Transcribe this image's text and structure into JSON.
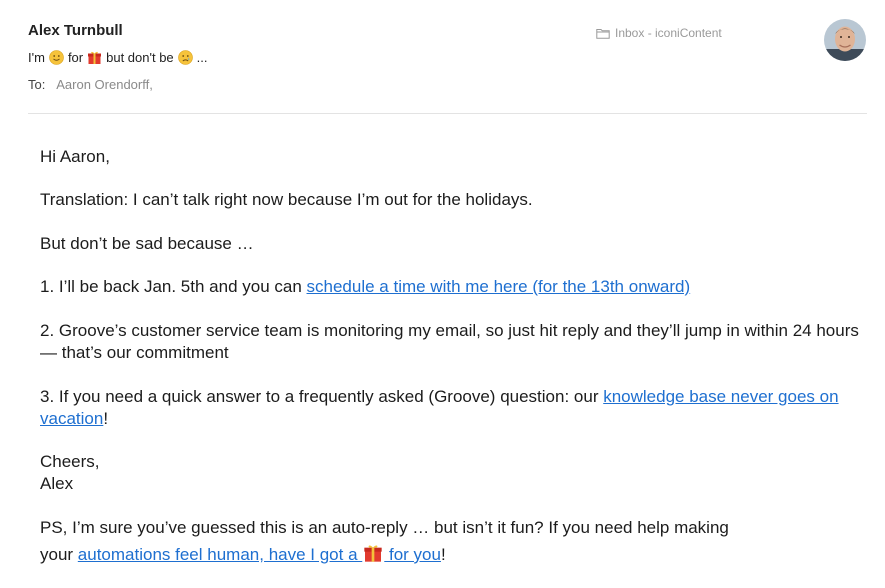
{
  "header": {
    "sender": "Alex Turnbull",
    "subject": {
      "part1": "I'm",
      "part2": "for",
      "part3": "but don't be",
      "part4": "..."
    },
    "to_label": "To:",
    "to_value": "Aaron Orendorff,",
    "mailbox": "Inbox - iconiContent"
  },
  "email": {
    "greeting": "Hi Aaron,",
    "translation": "Translation: I can’t talk right now because I’m out for the holidays.",
    "not_sad": "But don’t be sad because …",
    "point1_text": "1. I’ll be back Jan. 5th and you can ",
    "point1_link": "schedule a time with me here (for the 13th onward)",
    "point2": "2. Groove’s customer service team is monitoring my email, so just hit reply and they’ll jump in within 24 hours — that’s our commitment",
    "point3_text": "3. If you need a quick answer to a frequently asked (Groove) question: our ",
    "point3_link": "knowledge base never goes on vacation",
    "point3_end": "!",
    "signoff": "Cheers,",
    "signature": "Alex",
    "ps_text1": "PS, I’m sure you’ve guessed this is an auto-reply … but isn’t it fun? If you need help making",
    "ps_text2": "your ",
    "ps_link1": "automations feel human, have I got a ",
    "ps_link2": " for you",
    "ps_end": "!"
  },
  "colors": {
    "link": "#1e6fd0",
    "divider": "#e3e3e3",
    "muted": "#9a9a9a"
  },
  "icons": {
    "smile": "smiling-face-emoji",
    "gift": "wrapped-gift-emoji",
    "sad": "sad-face-emoji",
    "mailbox": "folder-icon"
  }
}
